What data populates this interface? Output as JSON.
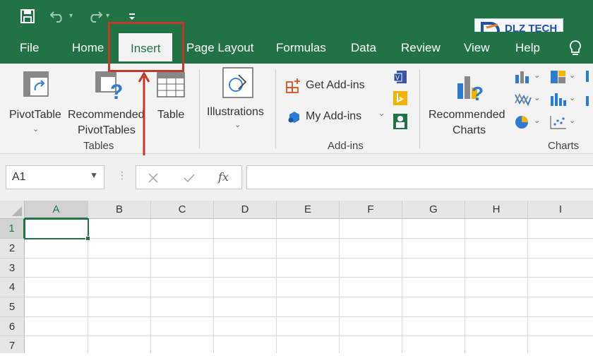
{
  "quick_access": {
    "save_icon": "save-icon",
    "undo_icon": "undo-icon",
    "redo_icon": "redo-icon",
    "customize_icon": "customize-qat-icon"
  },
  "watermark": {
    "text": "DLZ TECH"
  },
  "tabs": [
    {
      "key": "file",
      "label": "File"
    },
    {
      "key": "home",
      "label": "Home"
    },
    {
      "key": "insert",
      "label": "Insert"
    },
    {
      "key": "page_layout",
      "label": "Page Layout"
    },
    {
      "key": "formulas",
      "label": "Formulas"
    },
    {
      "key": "data",
      "label": "Data"
    },
    {
      "key": "review",
      "label": "Review"
    },
    {
      "key": "view",
      "label": "View"
    },
    {
      "key": "help",
      "label": "Help"
    }
  ],
  "ribbon": {
    "pivottable": "PivotTable",
    "recommended_pivot_1": "Recommended",
    "recommended_pivot_2": "PivotTables",
    "table": "Table",
    "tables_group": "Tables",
    "illustrations": "Illustrations",
    "get_addins": "Get Add-ins",
    "my_addins": "My Add-ins",
    "addins_group": "Add-ins",
    "recommended_charts_1": "Recommended",
    "recommended_charts_2": "Charts",
    "charts_group": "Charts"
  },
  "formula_bar": {
    "name_box": "A1",
    "fx": "fx"
  },
  "columns": [
    "A",
    "B",
    "C",
    "D",
    "E",
    "F",
    "G",
    "H",
    "I"
  ],
  "rows": [
    "1",
    "2",
    "3",
    "4",
    "5",
    "6",
    "7"
  ],
  "colors": {
    "excel_green": "#217346",
    "annotation_red": "#c0392b"
  }
}
